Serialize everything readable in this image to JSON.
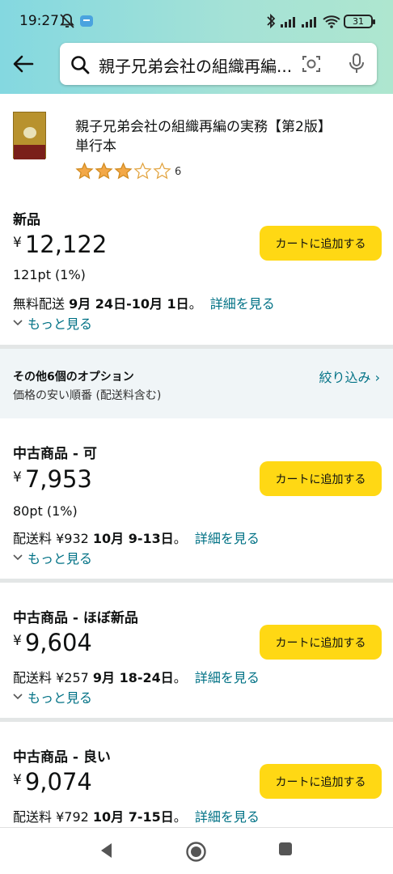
{
  "status": {
    "time": "19:27",
    "battery": "31"
  },
  "search": {
    "query": "親子兄弟会社の組織再編..."
  },
  "product": {
    "title": "親子兄弟会社の組織再編の実務【第2版】",
    "format": "単行本",
    "rating": 3,
    "rating_max": 5,
    "review_count": "6"
  },
  "offers": [
    {
      "condition": "新品",
      "currency": "¥",
      "price": "12,122",
      "points": "121pt (1%)",
      "ship_prefix": "無料配送 ",
      "ship_dates": "9月 24日-10月 1日",
      "ship_suffix": "。",
      "details": "詳細を見る",
      "more": "もっと見る",
      "cart": "カートに追加する"
    },
    {
      "condition": "中古商品 - 可",
      "currency": "¥",
      "price": "7,953",
      "points": "80pt (1%)",
      "ship_prefix": "配送料 ¥932 ",
      "ship_dates": "10月 9-13日",
      "ship_suffix": "。",
      "details": "詳細を見る",
      "more": "もっと見る",
      "cart": "カートに追加する"
    },
    {
      "condition": "中古商品 - ほぼ新品",
      "currency": "¥",
      "price": "9,604",
      "ship_prefix": "配送料 ¥257 ",
      "ship_dates": "9月 18-24日",
      "ship_suffix": "。",
      "details": "詳細を見る",
      "more": "もっと見る",
      "cart": "カートに追加する"
    },
    {
      "condition": "中古商品 - 良い",
      "currency": "¥",
      "price": "9,074",
      "ship_prefix": "配送料 ¥792 ",
      "ship_dates": "10月 7-15日",
      "ship_suffix": "。",
      "details": "詳細を見る",
      "cart": "カートに追加する"
    }
  ],
  "filter": {
    "heading": "その他6個のオプション",
    "sort": "価格の安い順番 (配送料含む)",
    "link": "絞り込み ›"
  },
  "colors": {
    "accent_link": "#007185",
    "cart_button": "#ffd814",
    "star": "#f3a847"
  }
}
